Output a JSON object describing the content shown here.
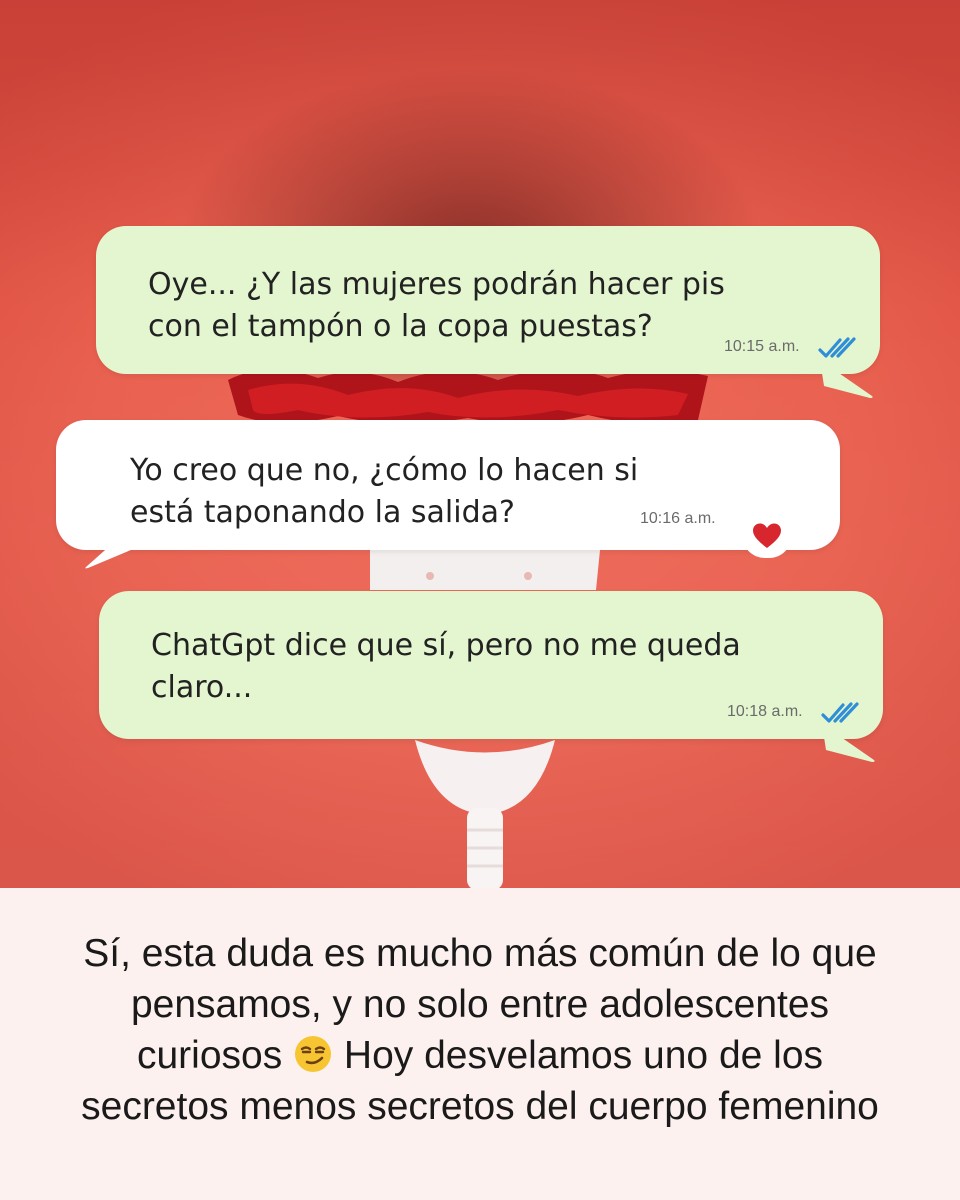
{
  "messages": [
    {
      "text_line1": "Oye... ¿Y las mujeres podrán hacer pis",
      "text_line2": "con el tampón o la copa puestas?",
      "time": "10:15 a.m.",
      "status_icon": "double-check-icon"
    },
    {
      "text_line1": "Yo creo que no, ¿cómo lo hacen si",
      "text_line2": "está taponando la salida?",
      "time": "10:16 a.m.",
      "reaction_icon": "heart-icon"
    },
    {
      "text_line1": "ChatGpt dice que sí, pero no me queda",
      "text_line2": "claro...",
      "time": "10:18 a.m.",
      "status_icon": "double-check-icon"
    }
  ],
  "caption": {
    "line1": "Sí, esta duda es mucho más común de lo que",
    "line2": "pensamos, y no solo entre adolescentes",
    "line3a": "curiosos",
    "line3_emoji": "smirking-face-emoji",
    "line3b": "Hoy desvelamos uno de los",
    "line4": "secretos menos secretos del cuerpo femenino"
  },
  "colors": {
    "sent_bubble": "#e4f6cf",
    "received_bubble": "#ffffff",
    "checkmarks": "#2f8fd6",
    "heart": "#d8262e",
    "caption_bg": "#fdf1ef"
  }
}
